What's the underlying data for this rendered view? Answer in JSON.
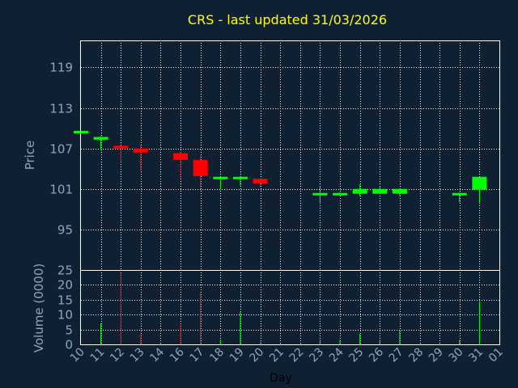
{
  "title": "CRS - last updated 31/03/2026",
  "colors": {
    "background": "#0f2033",
    "up": "#00ff00",
    "down": "#ff0000",
    "text": "#8fa4c0",
    "title": "#ffff00"
  },
  "chart_data": [
    {
      "type": "candlestick",
      "ylabel": "Price",
      "ylim": [
        89,
        123
      ],
      "yticks": [
        95,
        101,
        107,
        113,
        119
      ],
      "grid": true,
      "x_days": [
        "10",
        "11",
        "12",
        "13",
        "14",
        "16",
        "17",
        "18",
        "19",
        "20",
        "21",
        "22",
        "23",
        "24",
        "25",
        "26",
        "27",
        "28",
        "29",
        "30",
        "31",
        "01"
      ],
      "candles": [
        {
          "day": "10",
          "open": 109.4,
          "high": 109.4,
          "low": 109.4,
          "close": 109.6
        },
        {
          "day": "11",
          "open": 108.3,
          "high": 108.8,
          "low": 106.8,
          "close": 108.7
        },
        {
          "day": "12",
          "open": 107.4,
          "high": 107.5,
          "low": 105.0,
          "close": 107.0
        },
        {
          "day": "13",
          "open": 107.0,
          "high": 107.5,
          "low": 103.7,
          "close": 106.4
        },
        {
          "day": "16",
          "open": 106.3,
          "high": 106.5,
          "low": 102.5,
          "close": 105.3
        },
        {
          "day": "17",
          "open": 105.3,
          "high": 106.0,
          "low": 101.0,
          "close": 102.9
        },
        {
          "day": "18",
          "open": 102.7,
          "high": 102.8,
          "low": 101.0,
          "close": 102.8
        },
        {
          "day": "19",
          "open": 102.7,
          "high": 102.8,
          "low": 101.5,
          "close": 102.8
        },
        {
          "day": "20",
          "open": 102.5,
          "high": 102.5,
          "low": 101.2,
          "close": 101.8
        },
        {
          "day": "23",
          "open": 100.3,
          "high": 101.5,
          "low": 98.8,
          "close": 100.4
        },
        {
          "day": "24",
          "open": 100.3,
          "high": 100.5,
          "low": 100.2,
          "close": 100.4
        },
        {
          "day": "25",
          "open": 100.3,
          "high": 101.7,
          "low": 99.9,
          "close": 101.0
        },
        {
          "day": "26",
          "open": 100.3,
          "high": 101.4,
          "low": 100.3,
          "close": 101.0
        },
        {
          "day": "27",
          "open": 100.3,
          "high": 101.0,
          "low": 99.9,
          "close": 101.0
        },
        {
          "day": "30",
          "open": 100.3,
          "high": 100.5,
          "low": 99.0,
          "close": 100.4
        },
        {
          "day": "31",
          "open": 100.9,
          "high": 102.8,
          "low": 98.8,
          "close": 102.8
        }
      ]
    },
    {
      "type": "bar",
      "ylabel": "Volume (0000)",
      "xlabel": "Day",
      "ylim": [
        0,
        25
      ],
      "yticks": [
        0,
        5,
        10,
        15,
        20,
        25
      ],
      "grid": true,
      "x_days": [
        "10",
        "11",
        "12",
        "13",
        "14",
        "16",
        "17",
        "18",
        "19",
        "20",
        "21",
        "22",
        "23",
        "24",
        "25",
        "26",
        "27",
        "28",
        "29",
        "30",
        "31",
        "01"
      ],
      "bars": [
        {
          "day": "11",
          "value": 7,
          "dir": "up"
        },
        {
          "day": "12",
          "value": 24,
          "dir": "down"
        },
        {
          "day": "13",
          "value": 3.5,
          "dir": "down"
        },
        {
          "day": "16",
          "value": 7,
          "dir": "down"
        },
        {
          "day": "17",
          "value": 17.5,
          "dir": "down"
        },
        {
          "day": "18",
          "value": 1.5,
          "dir": "up"
        },
        {
          "day": "19",
          "value": 11,
          "dir": "up"
        },
        {
          "day": "20",
          "value": 1,
          "dir": "down"
        },
        {
          "day": "23",
          "value": 1.5,
          "dir": "up"
        },
        {
          "day": "24",
          "value": 1.5,
          "dir": "up"
        },
        {
          "day": "25",
          "value": 3.5,
          "dir": "up"
        },
        {
          "day": "26",
          "value": 1,
          "dir": "up"
        },
        {
          "day": "27",
          "value": 4.5,
          "dir": "up"
        },
        {
          "day": "30",
          "value": 1.5,
          "dir": "up"
        },
        {
          "day": "31",
          "value": 14.5,
          "dir": "up"
        }
      ]
    }
  ]
}
